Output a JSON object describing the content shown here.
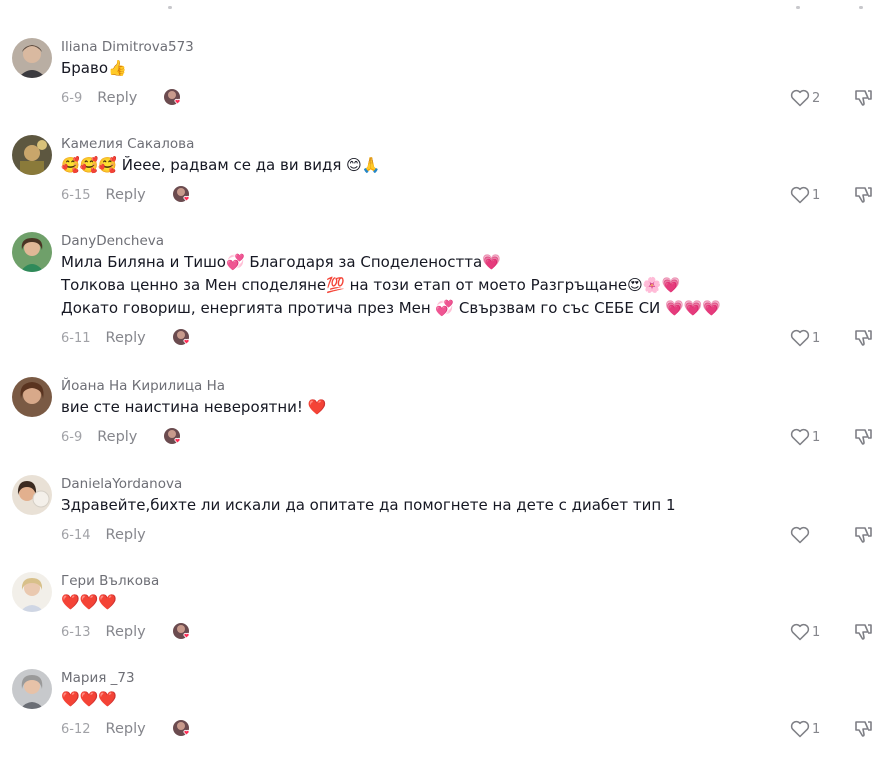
{
  "colors": {
    "username": "#6e6f76",
    "text": "#161823",
    "meta": "#a1a2a7",
    "reply": "#85868c",
    "heart_badge": "#fe2c55"
  },
  "icons": {
    "like": "heart-outline-icon",
    "dislike": "thumbs-down-icon",
    "creator_like": "creator-liked-avatar-icon"
  },
  "comments": [
    {
      "username": "Iliana Dimitrova573",
      "lines": [
        "Браво👍"
      ],
      "date": "6-9",
      "reply_label": "Reply",
      "likes": "2",
      "creator_liked": true
    },
    {
      "username": "Камелия Сакалова",
      "lines": [
        "🥰🥰🥰 Йеее, радвам се да ви видя 😊🙏"
      ],
      "date": "6-15",
      "reply_label": "Reply",
      "likes": "1",
      "creator_liked": true
    },
    {
      "username": "DanyDencheva",
      "lines": [
        "Мила Биляна и Тишо💞 Благодаря за Споделеността💗",
        "Толкова ценно за Мен споделяне💯 на този етап от моето Разгръщане😍🌸💗",
        "Докато говориш, енергията протича през Мен 💞 Свързвам го със СЕБЕ СИ 💗💗💗"
      ],
      "date": "6-11",
      "reply_label": "Reply",
      "likes": "1",
      "creator_liked": true
    },
    {
      "username": "Йоана На Кирилица На",
      "lines": [
        "вие сте наистина невероятни! ❤️"
      ],
      "date": "6-9",
      "reply_label": "Reply",
      "likes": "1",
      "creator_liked": true
    },
    {
      "username": "DanielaYordanova",
      "lines": [
        "Здравейте,бихте ли искали да опитате да помогнете на дете с диабет тип 1"
      ],
      "date": "6-14",
      "reply_label": "Reply",
      "likes": "",
      "creator_liked": false
    },
    {
      "username": "Гери Вълкова",
      "lines": [
        "❤️❤️❤️"
      ],
      "date": "6-13",
      "reply_label": "Reply",
      "likes": "1",
      "creator_liked": true
    },
    {
      "username": "Мария _73",
      "lines": [
        "❤️❤️❤️"
      ],
      "date": "6-12",
      "reply_label": "Reply",
      "likes": "1",
      "creator_liked": true
    }
  ]
}
